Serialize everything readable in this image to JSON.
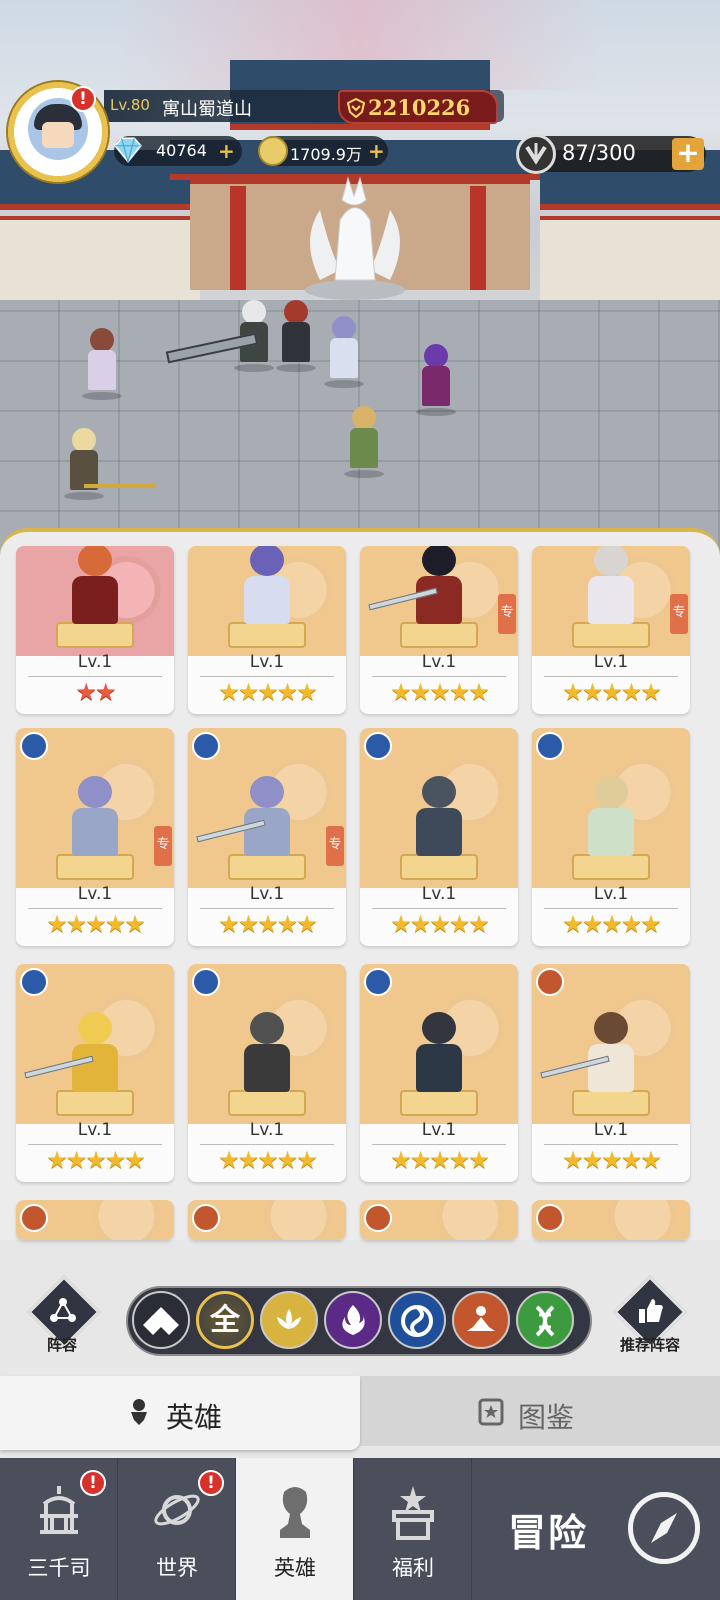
{
  "player": {
    "level": "Lv.80",
    "name": "寓山蜀道山",
    "power": "2210226",
    "alert": "!"
  },
  "resources": {
    "diamonds": "40764",
    "gold": "1709.9万",
    "plus": "+",
    "stamina": "87/300"
  },
  "hero_cards": [
    {
      "level": "Lv.1",
      "stars": "★★",
      "star_style": "red",
      "faction": "none",
      "badge": ""
    },
    {
      "level": "Lv.1",
      "stars": "★★★★★",
      "star_style": "gold",
      "faction": "none",
      "badge": ""
    },
    {
      "level": "Lv.1",
      "stars": "★★★★★",
      "star_style": "gold",
      "faction": "none",
      "badge": "专"
    },
    {
      "level": "Lv.1",
      "stars": "★★★★★",
      "star_style": "gold",
      "faction": "none",
      "badge": "专"
    },
    {
      "level": "Lv.1",
      "stars": "★★★★★",
      "star_style": "gold",
      "faction": "wind",
      "badge": "专"
    },
    {
      "level": "Lv.1",
      "stars": "★★★★★",
      "star_style": "gold",
      "faction": "wind",
      "badge": "专"
    },
    {
      "level": "Lv.1",
      "stars": "★★★★★",
      "star_style": "gold",
      "faction": "wind",
      "badge": ""
    },
    {
      "level": "Lv.1",
      "stars": "★★★★★",
      "star_style": "gold",
      "faction": "wind",
      "badge": ""
    },
    {
      "level": "Lv.1",
      "stars": "★★★★★",
      "star_style": "gold",
      "faction": "wind",
      "badge": ""
    },
    {
      "level": "Lv.1",
      "stars": "★★★★★",
      "star_style": "gold",
      "faction": "wind",
      "badge": ""
    },
    {
      "level": "Lv.1",
      "stars": "★★★★★",
      "star_style": "gold",
      "faction": "wind",
      "badge": ""
    },
    {
      "level": "Lv.1",
      "stars": "★★★★★",
      "star_style": "gold",
      "faction": "monk",
      "badge": ""
    }
  ],
  "partial_row_factions": [
    "monk",
    "monk",
    "monk",
    "monk"
  ],
  "filters": {
    "all_label": "全",
    "icons": [
      "diamond-filter-icon",
      "all",
      "lotus-icon",
      "flame-icon",
      "wind-icon",
      "meditation-icon",
      "dna-icon"
    ],
    "colors": [
      "#2a2d35",
      "#3a3e4a",
      "#d9b340",
      "#5a2a86",
      "#1f4f9a",
      "#c2572d",
      "#3b9b3e"
    ]
  },
  "side_buttons": {
    "lineup": "阵容",
    "recommended_lineup": "推荐阵容"
  },
  "tabs": {
    "heroes": "英雄",
    "codex": "图鉴"
  },
  "nav": {
    "sanqiansi": "三千司",
    "world": "世界",
    "heroes": "英雄",
    "welfare": "福利",
    "adventure": "冒险"
  },
  "colors": {
    "gold_star": "#f2b92a",
    "red_star": "#ea5a3e",
    "card_bg": "#f0c88e",
    "accent_gold": "#d8b64a",
    "power_red": "#7a1b1b",
    "nav_dark": "#4a4f5b"
  }
}
